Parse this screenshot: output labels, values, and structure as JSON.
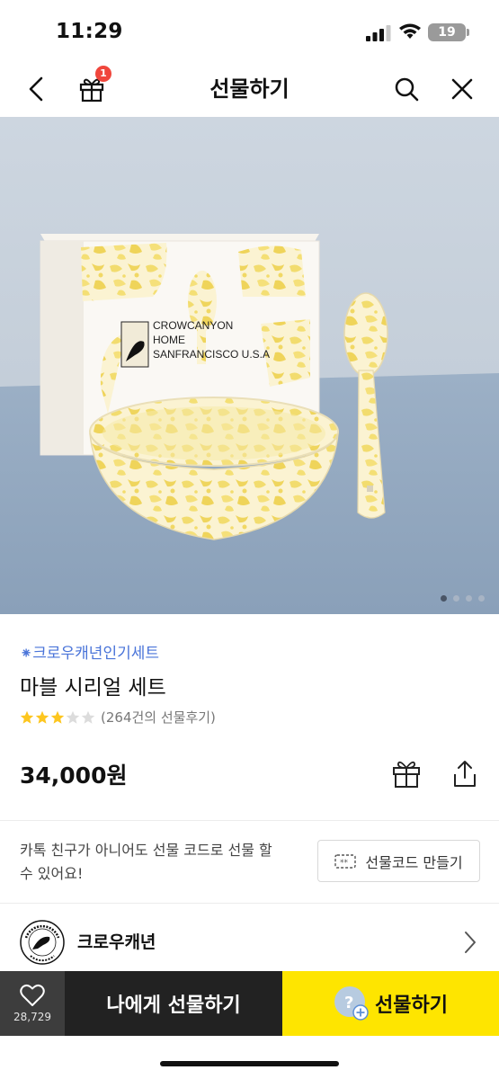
{
  "status_bar": {
    "time": "11:29",
    "battery": "19"
  },
  "header": {
    "title": "선물하기",
    "gift_badge": "1"
  },
  "hero": {
    "box_text_line1": "CROWCANYON",
    "box_text_line2": "HOME",
    "box_text_line3": "SANFRANCISCO U.S.A"
  },
  "product": {
    "category": "⁕크로우캐년인기세트",
    "name": "마블 시리얼 세트",
    "rating": 3,
    "rating_max": 5,
    "review_count": "(264건의 선물후기)",
    "price": "34,000원"
  },
  "gift_code": {
    "text": "카톡 친구가 아니어도 선물 코드로 선물 할 수 있어요!",
    "button_label": "선물코드 만들기"
  },
  "brand": {
    "name": "크로우캐년"
  },
  "bottom_bar": {
    "like_count": "28,729",
    "self_gift_label": "나에게 선물하기",
    "gift_label": "선물하기"
  },
  "colors": {
    "accent_yellow": "#fee500",
    "category_blue": "#4a74d9",
    "badge_red": "#f0463c"
  }
}
